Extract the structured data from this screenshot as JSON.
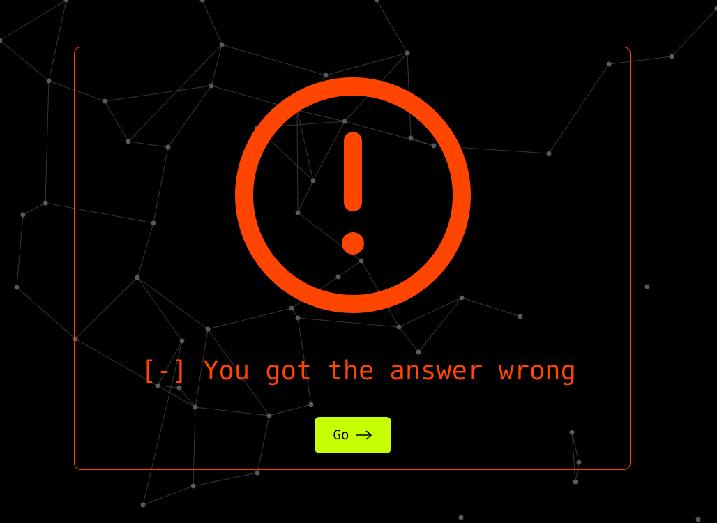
{
  "message": {
    "prefix": "[-]",
    "text": "You got the answer wrong"
  },
  "button": {
    "label": "Go",
    "icon": "arrow-right-icon"
  },
  "icons": {
    "alert": "exclamation-circle-icon"
  },
  "colors": {
    "background": "#000000",
    "accent": "#ff4500",
    "card_border": "#ff3d1f",
    "button": "#c6ff00",
    "network": "#4a4a4a"
  }
}
